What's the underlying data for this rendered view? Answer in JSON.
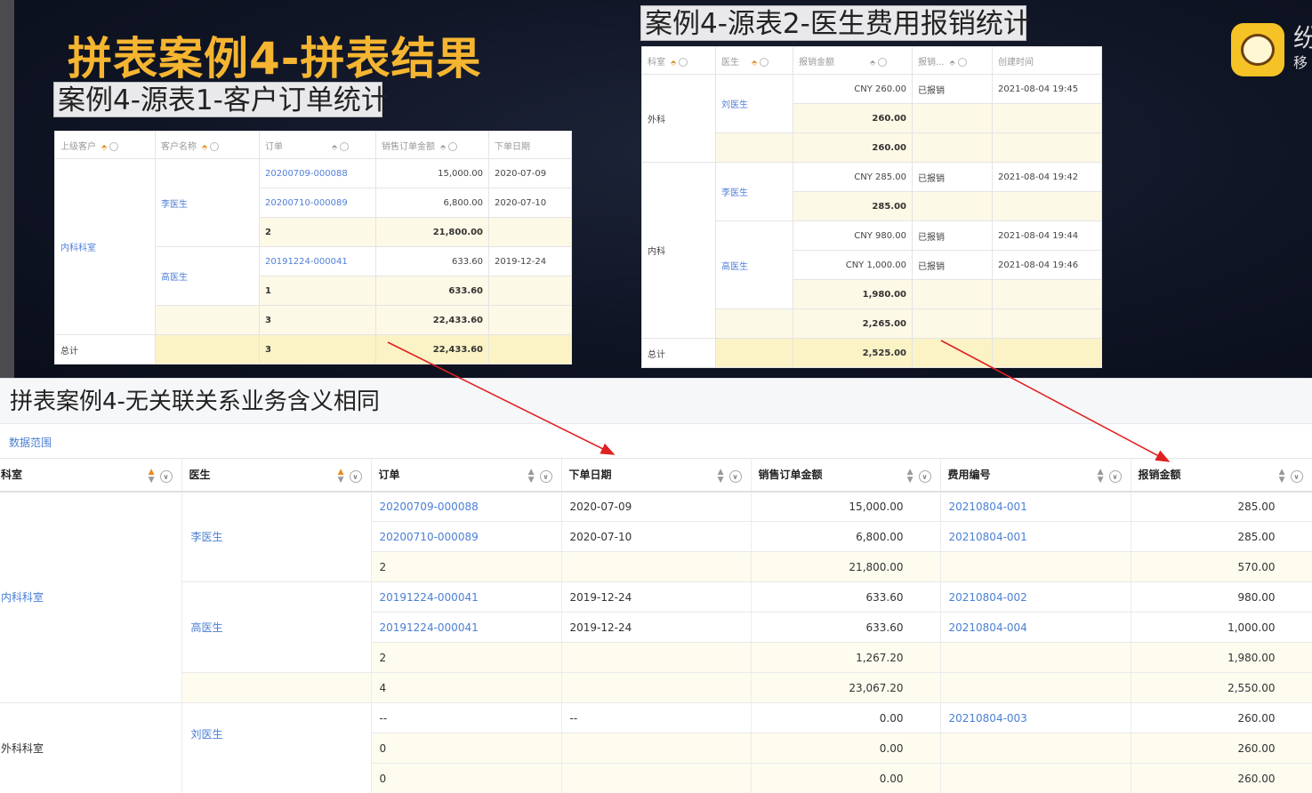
{
  "slide": {
    "title": "拼表案例4-拼表结果",
    "src1_label": "案例4-源表1-客户订单统计",
    "src2_label": "案例4-源表2-医生费用报销统计",
    "brand_text": "纷",
    "brand_sub": "移"
  },
  "source1": {
    "headers": [
      "上级客户",
      "客户名称",
      "订单",
      "销售订单金额",
      "下单日期"
    ],
    "parent": "内科科室",
    "customers": [
      "李医生",
      "高医生"
    ],
    "rows": [
      {
        "order": "20200709-000088",
        "amount": "15,000.00",
        "date": "2020-07-09"
      },
      {
        "order": "20200710-000089",
        "amount": "6,800.00",
        "date": "2020-07-10"
      },
      {
        "order": "2",
        "amount": "21,800.00",
        "date": ""
      },
      {
        "order": "20191224-000041",
        "amount": "633.60",
        "date": "2019-12-24"
      },
      {
        "order": "1",
        "amount": "633.60",
        "date": ""
      },
      {
        "order": "3",
        "amount": "22,433.60",
        "date": ""
      }
    ],
    "total_label": "总计",
    "total_count": "3",
    "total_amount": "22,433.60"
  },
  "source2": {
    "headers": [
      "科室",
      "医生",
      "报销金额",
      "报销...",
      "创建时间"
    ],
    "dept_surgery": "外科",
    "dept_internal": "内科",
    "doctors": [
      "刘医生",
      "李医生",
      "高医生"
    ],
    "rows": [
      {
        "amount": "CNY 260.00",
        "status": "已报销",
        "time": "2021-08-04 19:45"
      },
      {
        "amount": "260.00"
      },
      {
        "amount": "260.00"
      },
      {
        "amount": "CNY 285.00",
        "status": "已报销",
        "time": "2021-08-04 19:42"
      },
      {
        "amount": "285.00"
      },
      {
        "amount": "CNY 980.00",
        "status": "已报销",
        "time": "2021-08-04 19:44"
      },
      {
        "amount": "CNY 1,000.00",
        "status": "已报销",
        "time": "2021-08-04 19:46"
      },
      {
        "amount": "1,980.00"
      },
      {
        "amount": "2,265.00"
      }
    ],
    "total_label": "总计",
    "total_amount": "2,525.00"
  },
  "page": {
    "title": "拼表案例4-无关联关系业务含义相同",
    "scope_link": "数据范围"
  },
  "table": {
    "headers": [
      "科室",
      "医生",
      "订单",
      "下单日期",
      "销售订单金额",
      "费用编号",
      "报销金额"
    ],
    "depts": [
      "内科科室",
      "外科科室"
    ],
    "doctors": [
      "李医生",
      "高医生",
      "刘医生"
    ],
    "rows": [
      {
        "order": "20200709-000088",
        "date": "2020-07-09",
        "amount": "15,000.00",
        "fee": "20210804-001",
        "reimb": "285.00"
      },
      {
        "order": "20200710-000089",
        "date": "2020-07-10",
        "amount": "6,800.00",
        "fee": "20210804-001",
        "reimb": "285.00"
      },
      {
        "order": "2",
        "date": "",
        "amount": "21,800.00",
        "fee": "",
        "reimb": "570.00"
      },
      {
        "order": "20191224-000041",
        "date": "2019-12-24",
        "amount": "633.60",
        "fee": "20210804-002",
        "reimb": "980.00"
      },
      {
        "order": "20191224-000041",
        "date": "2019-12-24",
        "amount": "633.60",
        "fee": "20210804-004",
        "reimb": "1,000.00"
      },
      {
        "order": "2",
        "date": "",
        "amount": "1,267.20",
        "fee": "",
        "reimb": "1,980.00"
      },
      {
        "order": "4",
        "date": "",
        "amount": "23,067.20",
        "fee": "",
        "reimb": "2,550.00"
      },
      {
        "order": "--",
        "date": "--",
        "amount": "0.00",
        "fee": "20210804-003",
        "reimb": "260.00"
      },
      {
        "order": "0",
        "date": "",
        "amount": "0.00",
        "fee": "",
        "reimb": "260.00"
      },
      {
        "order": "0",
        "date": "",
        "amount": "0.00",
        "fee": "",
        "reimb": "260.00"
      }
    ]
  },
  "colors": {
    "accent_link": "#4a7fd4",
    "title_gold": "#f5b531",
    "arrow_red": "#e02020",
    "subtotal_bg": "#fdfcef"
  }
}
